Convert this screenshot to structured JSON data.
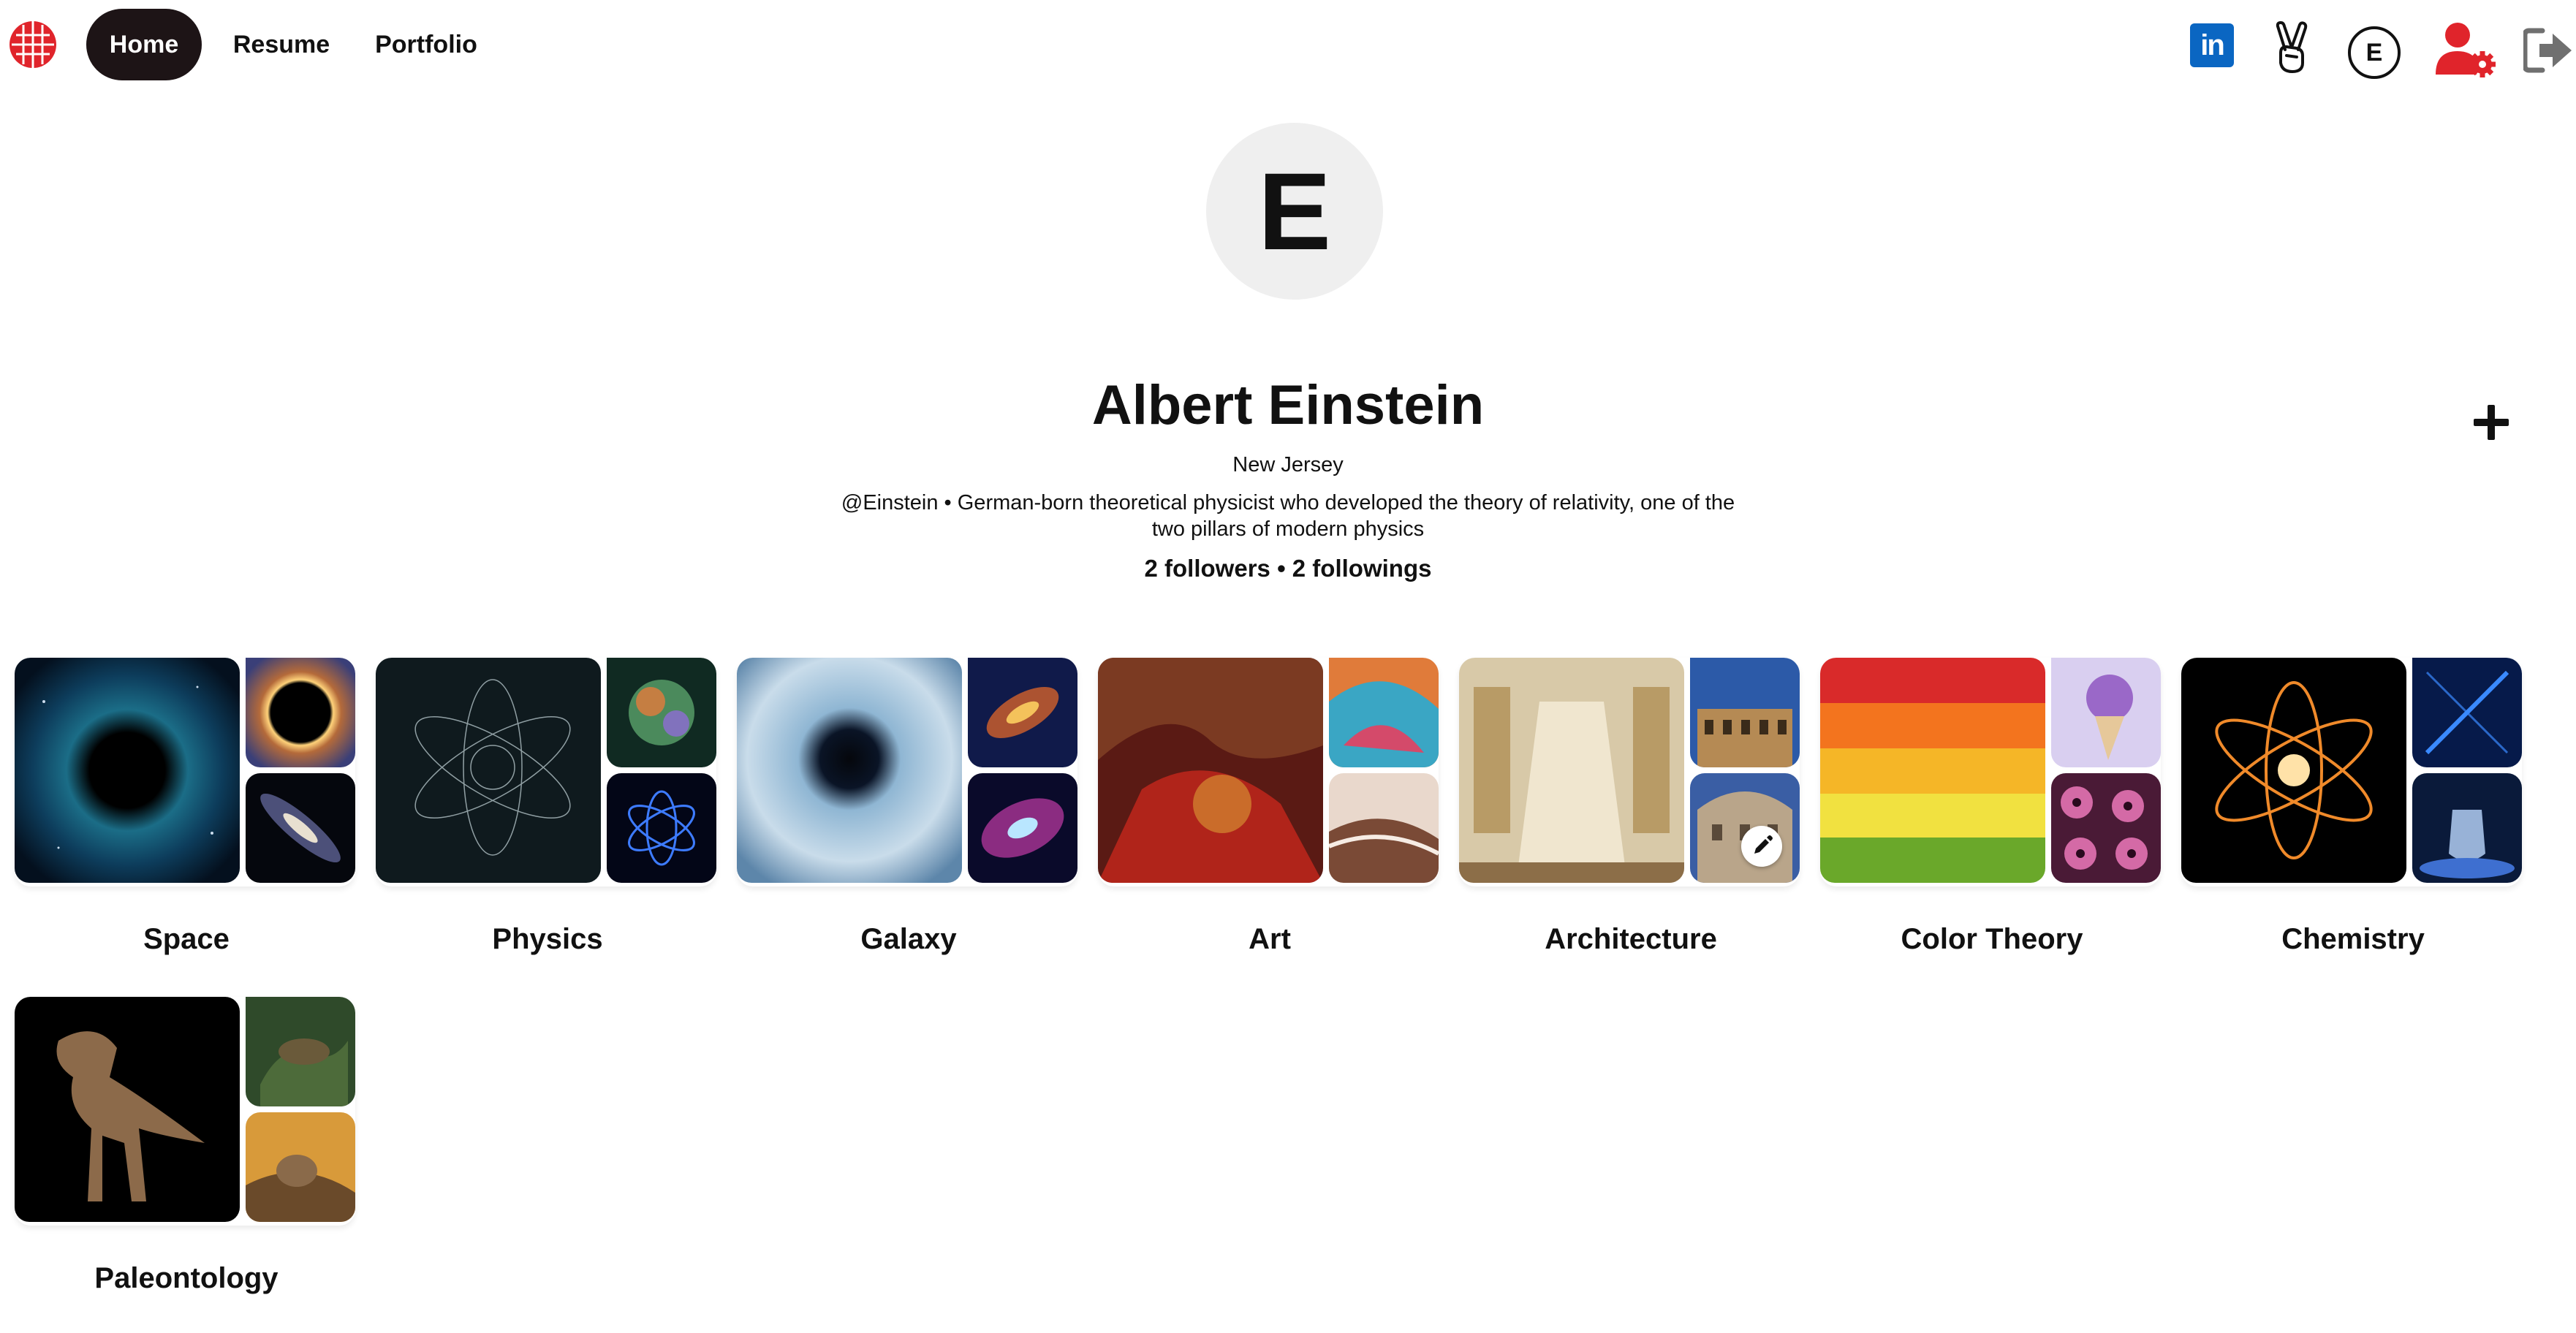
{
  "nav": {
    "home_label": "Home",
    "resume_label": "Resume",
    "portfolio_label": "Portfolio"
  },
  "header_icons": {
    "linkedin_text": "in",
    "avatar_initial": "E",
    "linkedin_color": "#0a66c2",
    "user_settings_color": "#e0242b"
  },
  "profile": {
    "initial": "E",
    "name": "Albert Einstein",
    "location": "New Jersey",
    "bio": "@Einstein • German-born theoretical physicist who developed the theory of relativity, one of the two pillars of modern physics",
    "stats": "2 followers • 2 followings"
  },
  "boards": [
    {
      "title": "Space"
    },
    {
      "title": "Physics"
    },
    {
      "title": "Galaxy"
    },
    {
      "title": "Art"
    },
    {
      "title": "Architecture"
    },
    {
      "title": "Color Theory"
    },
    {
      "title": "Chemistry"
    },
    {
      "title": "Paleontology"
    }
  ]
}
